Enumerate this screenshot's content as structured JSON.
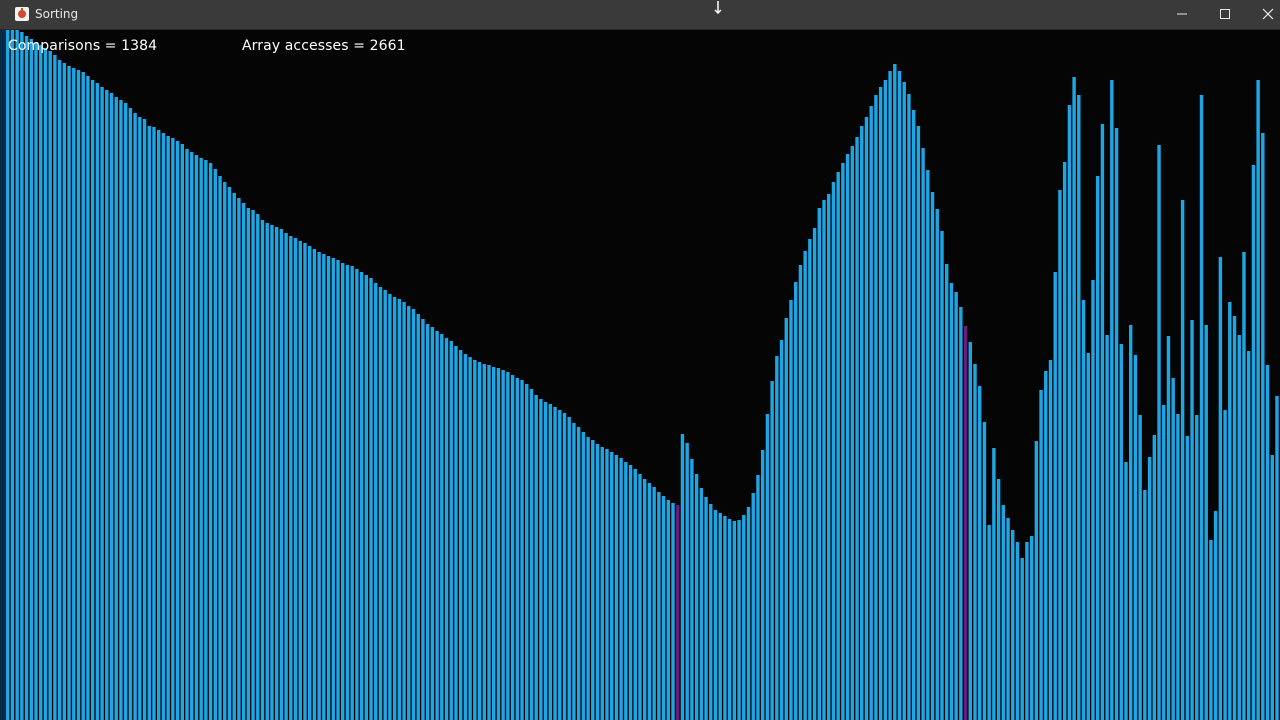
{
  "window": {
    "title": "Sorting",
    "controls": {
      "minimize": "minimize-icon",
      "maximize": "maximize-icon",
      "close": "close-icon"
    }
  },
  "stats": {
    "comparisons": "Comparisons = 1384",
    "array_accesses": "Array accesses = 2661"
  },
  "colors": {
    "bar": "#1ea6e4",
    "highlight": "#6d1b7b",
    "background": "#050505",
    "titlebar": "#3a3a3a"
  },
  "chart_data": {
    "type": "bar",
    "title": "",
    "xlabel": "",
    "ylabel": "",
    "ylim": [
      0,
      690
    ],
    "grid": false,
    "highlight_indices": [
      142,
      203
    ],
    "values": [
      690,
      690,
      690,
      688,
      684,
      681,
      678,
      675,
      672,
      669,
      665,
      660,
      657,
      654,
      652,
      650,
      648,
      644,
      640,
      637,
      633,
      630,
      627,
      623,
      620,
      617,
      612,
      607,
      603,
      601,
      594,
      593,
      590,
      587,
      584,
      582,
      579,
      576,
      571,
      568,
      565,
      562,
      560,
      557,
      551,
      544,
      538,
      533,
      527,
      522,
      517,
      512,
      510,
      506,
      500,
      497,
      495,
      493,
      491,
      487,
      484,
      482,
      479,
      477,
      474,
      471,
      468,
      466,
      464,
      462,
      460,
      457,
      455,
      454,
      451,
      448,
      445,
      442,
      437,
      433,
      430,
      426,
      423,
      421,
      418,
      414,
      411,
      406,
      401,
      396,
      393,
      389,
      386,
      382,
      379,
      374,
      370,
      366,
      363,
      360,
      358,
      356,
      355,
      353,
      352,
      350,
      348,
      345,
      342,
      340,
      336,
      331,
      325,
      321,
      318,
      316,
      313,
      310,
      307,
      303,
      297,
      293,
      288,
      283,
      280,
      276,
      273,
      271,
      268,
      265,
      262,
      258,
      255,
      251,
      246,
      241,
      237,
      233,
      228,
      224,
      220,
      217,
      215,
      286,
      277,
      261,
      246,
      232,
      223,
      216,
      210,
      207,
      204,
      201,
      199,
      200,
      205,
      213,
      227,
      245,
      270,
      306,
      339,
      364,
      380,
      402,
      420,
      438,
      455,
      469,
      481,
      492,
      512,
      520,
      526,
      538,
      548,
      557,
      566,
      574,
      583,
      594,
      603,
      614,
      625,
      633,
      640,
      649,
      656,
      649,
      638,
      626,
      610,
      594,
      572,
      550,
      528,
      511,
      489,
      456,
      437,
      428,
      413,
      394,
      378,
      356,
      334,
      298,
      195,
      272,
      241,
      215,
      202,
      190,
      178,
      162,
      178,
      184,
      279,
      330,
      349,
      360,
      448,
      530,
      558,
      615,
      643,
      625,
      420,
      367,
      440,
      544,
      596,
      385,
      640,
      592,
      376,
      258,
      395,
      365,
      305,
      230,
      263,
      285,
      575,
      315,
      384,
      342,
      306,
      520,
      284,
      400,
      305,
      625,
      395,
      180,
      209,
      463,
      310,
      418,
      404,
      385,
      468,
      369,
      555,
      640,
      587,
      355,
      265,
      324
    ]
  }
}
